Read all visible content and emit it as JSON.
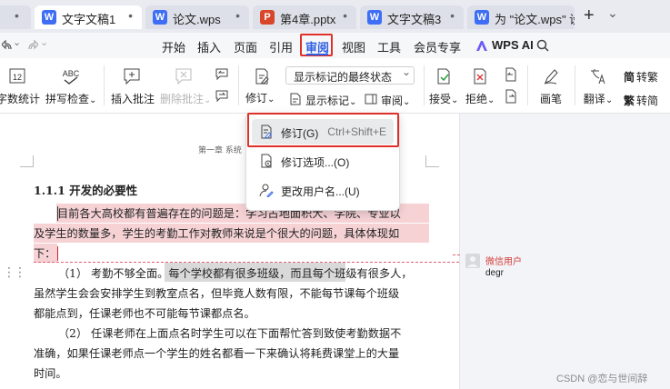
{
  "tabs": [
    {
      "label": "文字文稿1",
      "icon": "W",
      "color": "#3d6ef5",
      "active": true
    },
    {
      "label": "论文.wps",
      "icon": "W",
      "color": "#3d6ef5"
    },
    {
      "label": "第4章.pptx",
      "icon": "P",
      "color": "#d9472b"
    },
    {
      "label": "文字文稿3",
      "icon": "W",
      "color": "#3d6ef5"
    },
    {
      "label": "为 \"论文.wps\" 设",
      "icon": "W",
      "color": "#3d6ef5"
    }
  ],
  "tab_dot": "•",
  "new_tab": "+",
  "chevron": "⌄",
  "menu": {
    "items": [
      "开始",
      "插入",
      "页面",
      "引用",
      "审阅",
      "视图",
      "工具",
      "会员专享"
    ],
    "active": "审阅",
    "wps_ai": "WPS AI"
  },
  "ribbon": {
    "word_count": "字数统计",
    "spell_check": "拼写检查",
    "insert_comment": "插入批注",
    "delete_comment": "删除批注",
    "track_changes": "修订",
    "display_mode": "显示标记的最终状态",
    "show_markup": "显示标记",
    "review_pane": "审阅",
    "accept": "接受",
    "reject": "拒绝",
    "pen": "画笔",
    "translate": "翻译",
    "to_trad": "转繁",
    "to_simp": "转简"
  },
  "dropdown": {
    "items": [
      {
        "label": "修订(G)",
        "shortcut": "Ctrl+Shift+E"
      },
      {
        "label": "修订选项...(O)",
        "shortcut": ""
      },
      {
        "label": "更改用户名...(U)",
        "shortcut": ""
      }
    ]
  },
  "document": {
    "header": "第一章  系统",
    "heading": "1.1.1  开发的必要性",
    "p1_line1": "目前各大高校都有普遍存在的问题是：学习占地面积大、学院、专业以",
    "p1_line2": "及学生的数量多，学生的考勤工作对教师来说是个很大的问题，具体体现如",
    "p1_line3": "下：",
    "p2_line1_a": "（1） 考勤不够全面。",
    "p2_line1_b": "每个学校都有很多班级，而且每个",
    "p2_line1_c": "班级有很多人，",
    "p2_line2": "虽然学生会会安排学生到教室点名，但毕竟人数有限，不能每节课每个班级",
    "p2_line3": "都能点到，任课老师也不可能每节课都点名。",
    "p3_line1": "（2） 任课老师在上面点名时学生可以在下面帮忙答到致使考勤数据不",
    "p3_line2": "准确，如果任课老师点一个学生的姓名都看一下来确认将耗费课堂上的大量",
    "p3_line3": "时间。"
  },
  "comment": {
    "user": "微信用户",
    "text": "degr"
  },
  "watermark": "CSDN @恋与世间辞"
}
